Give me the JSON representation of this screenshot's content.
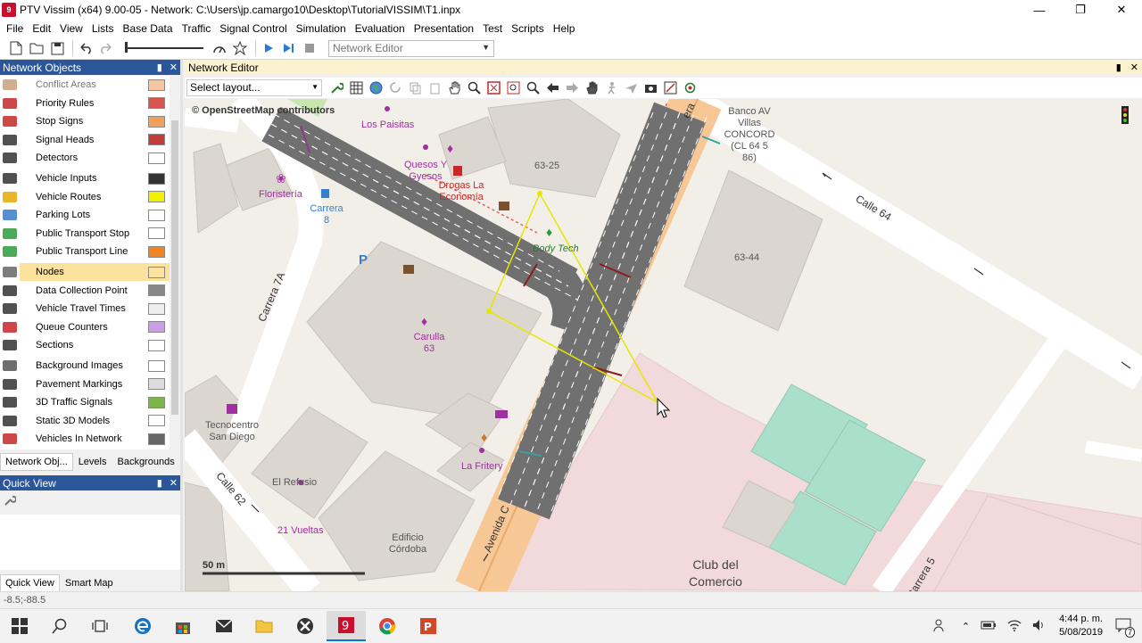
{
  "window": {
    "title": "PTV Vissim (x64) 9.00-05 - Network: C:\\Users\\jp.camargo10\\Desktop\\TutorialVISSIM\\T1.inpx",
    "app_icon_text": "9"
  },
  "menu": [
    "File",
    "Edit",
    "View",
    "Lists",
    "Base Data",
    "Traffic",
    "Signal Control",
    "Simulation",
    "Evaluation",
    "Presentation",
    "Test",
    "Scripts",
    "Help"
  ],
  "toolbar": {
    "editor_select_value": "Network Editor"
  },
  "network_objects": {
    "title": "Network Objects",
    "items": [
      {
        "label": "Conflict Areas",
        "icon": "conflict-area-icon",
        "dim": true,
        "swatch": "#f5c6a0"
      },
      {
        "label": "Priority Rules",
        "icon": "priority-rule-icon",
        "swatch": "#d9534f"
      },
      {
        "label": "Stop Signs",
        "icon": "stop-sign-icon",
        "swatch": "#f5a05a"
      },
      {
        "label": "Signal Heads",
        "icon": "signal-head-icon",
        "swatch": "#c23b3b"
      },
      {
        "label": "Detectors",
        "icon": "detector-icon",
        "swatch": "#ffffff"
      },
      {
        "label": "Vehicle Inputs",
        "icon": "vehicle-input-icon",
        "swatch": "#333333"
      },
      {
        "label": "Vehicle Routes",
        "icon": "vehicle-route-icon",
        "swatch": "#f0f000"
      },
      {
        "label": "Parking Lots",
        "icon": "parking-lot-icon",
        "swatch": "#ffffff"
      },
      {
        "label": "Public Transport Stop",
        "icon": "pt-stop-icon",
        "swatch": "#ffffff"
      },
      {
        "label": "Public Transport Line",
        "icon": "pt-line-icon",
        "swatch": "#f58220"
      },
      {
        "label": "Nodes",
        "icon": "node-icon",
        "selected": true,
        "swatch": "#fbe29d"
      },
      {
        "label": "Data Collection Point",
        "icon": "data-collection-icon",
        "swatch": "#888888"
      },
      {
        "label": "Vehicle Travel Times",
        "icon": "travel-time-icon",
        "swatch": "#eeeeee"
      },
      {
        "label": "Queue Counters",
        "icon": "queue-counter-icon",
        "swatch": "#c9a0e8"
      },
      {
        "label": "Sections",
        "icon": "section-icon",
        "swatch": "#ffffff"
      },
      {
        "label": "Background Images",
        "icon": "background-image-icon",
        "swatch": "#ffffff"
      },
      {
        "label": "Pavement Markings",
        "icon": "pavement-marking-icon",
        "swatch": "#dddddd"
      },
      {
        "label": "3D Traffic Signals",
        "icon": "traffic-signal-3d-icon",
        "swatch": "#7ab648"
      },
      {
        "label": "Static 3D Models",
        "icon": "static-3d-model-icon",
        "swatch": "#ffffff"
      },
      {
        "label": "Vehicles In Network",
        "icon": "vehicles-in-network-icon",
        "swatch": "#666666"
      }
    ],
    "tabs": [
      "Network Obj...",
      "Levels",
      "Backgrounds"
    ]
  },
  "quick_view": {
    "title": "Quick View",
    "tabs": [
      "Quick View",
      "Smart Map"
    ]
  },
  "editor": {
    "title": "Network Editor",
    "layout_select_value": "Select layout...",
    "attribution": "© OpenStreetMap contributors",
    "scale_label": "50 m",
    "street_labels": [
      "Calle 64",
      "Carrera 7A",
      "Calle 62",
      "Avenida C",
      "Carrera 5",
      "era"
    ],
    "place_labels": [
      "Banco AV Villas CONCORD (CL 64 5 86)",
      "63-25",
      "63-44",
      "Edificio Córdoba",
      "El Refusio",
      "Club del Comercio"
    ],
    "poi_labels": [
      "Los Paisitas",
      "Quesos Y Gyesos",
      "Drogas La Economía",
      "Floristería",
      "Carrera 8",
      "Body Tech",
      "Carulla 63",
      "Tecnocentro San Diego",
      "La Fritery",
      "21 Vueltas"
    ]
  },
  "status": {
    "coordinates": "-8.5;-88.5"
  },
  "taskbar": {
    "time": "4:44 p. m.",
    "date": "5/08/2019",
    "notification_count": "7"
  }
}
